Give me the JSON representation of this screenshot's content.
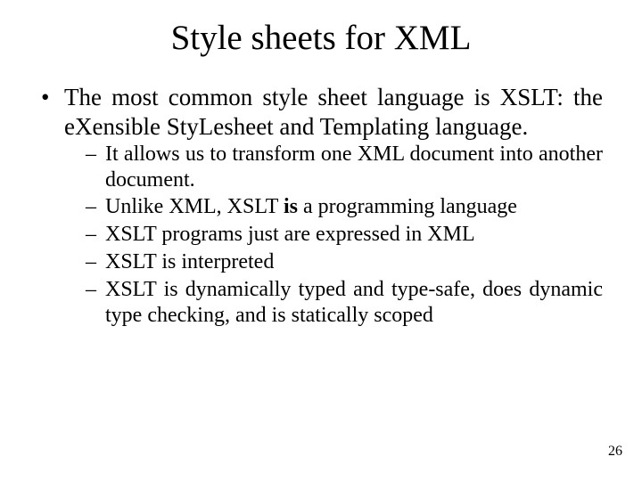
{
  "title": "Style sheets for XML",
  "bullets": [
    "The most common style sheet language is XSLT: the eXensible StyLesheet and Templating language."
  ],
  "sub_bullets": [
    {
      "parts": [
        {
          "text": "It allows us to transform one XML document into another document.",
          "bold": false
        }
      ]
    },
    {
      "parts": [
        {
          "text": "Unlike XML, XSLT ",
          "bold": false
        },
        {
          "text": "is",
          "bold": true
        },
        {
          "text": " a programming language",
          "bold": false
        }
      ]
    },
    {
      "parts": [
        {
          "text": "XSLT programs just are expressed in XML",
          "bold": false
        }
      ]
    },
    {
      "parts": [
        {
          "text": "XSLT is interpreted",
          "bold": false
        }
      ]
    },
    {
      "parts": [
        {
          "text": "XSLT is dynamically typed and type-safe, does dynamic type checking, and is statically scoped",
          "bold": false
        }
      ]
    }
  ],
  "slide_number": "26"
}
